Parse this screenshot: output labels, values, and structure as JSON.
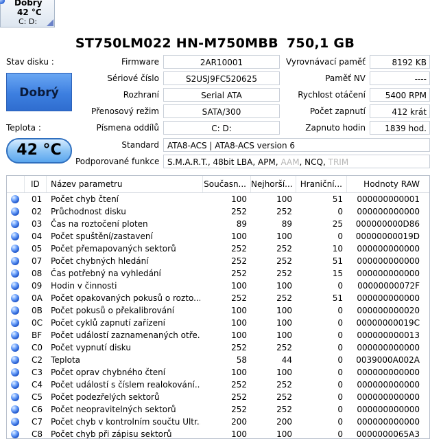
{
  "drive_tab": {
    "status": "Dobrý",
    "temperature": "42 °C",
    "letters": "C: D:"
  },
  "title": {
    "model": "ST750LM022 HN-M750MBB",
    "capacity": "750,1 GB"
  },
  "left": {
    "health_label": "Stav disku :",
    "health_value": "Dobrý",
    "temp_label": "Teplota :",
    "temp_value": "42 °C"
  },
  "info_center": [
    {
      "label": "Firmware",
      "value": "2AR10001"
    },
    {
      "label": "Sériové číslo",
      "value": "S2USJ9FC520625"
    },
    {
      "label": "Rozhraní",
      "value": "Serial ATA"
    },
    {
      "label": "Přenosový režim",
      "value": "SATA/300"
    },
    {
      "label": "Písmena oddílů",
      "value": "C: D:"
    }
  ],
  "info_right": [
    {
      "label": "Vyrovnávací paměť",
      "value": "8192 KB"
    },
    {
      "label": "Paměť NV",
      "value": "----"
    },
    {
      "label": "Rychlost otáčení",
      "value": "5400 RPM"
    },
    {
      "label": "Počet zapnutí",
      "value": "412 krát"
    },
    {
      "label": "Zapnuto hodin",
      "value": "1839 hod."
    }
  ],
  "standard": {
    "label": "Standard",
    "value": "ATA8-ACS | ATA8-ACS version 6"
  },
  "features": {
    "label": "Podporované funkce",
    "enabled": "S.M.A.R.T., 48bit LBA, APM,",
    "aam": "AAM",
    "ncq": ", NCQ,",
    "trim": "TRIM"
  },
  "table": {
    "headers": [
      "ID",
      "Název parametru",
      "Současn...",
      "Nejhorší...",
      "Hraniční...",
      "Hodnoty RAW"
    ],
    "rows": [
      [
        "01",
        "Počet chyb čtení",
        "100",
        "100",
        "51",
        "000000000001"
      ],
      [
        "02",
        "Průchodnost disku",
        "252",
        "252",
        "0",
        "000000000000"
      ],
      [
        "03",
        "Čas na roztočení ploten",
        "89",
        "89",
        "25",
        "000000000D86"
      ],
      [
        "04",
        "Počet spuštění/zastavení",
        "100",
        "100",
        "0",
        "00000000019D"
      ],
      [
        "05",
        "Počet přemapovaných sektorů",
        "252",
        "252",
        "10",
        "000000000000"
      ],
      [
        "07",
        "Počet chybných hledání",
        "252",
        "252",
        "51",
        "000000000000"
      ],
      [
        "08",
        "Čas potřebný na vyhledání",
        "252",
        "252",
        "15",
        "000000000000"
      ],
      [
        "09",
        "Hodin v činnosti",
        "100",
        "100",
        "0",
        "00000000072F"
      ],
      [
        "0A",
        "Počet opakovaných pokusů o rozto...",
        "252",
        "252",
        "51",
        "000000000000"
      ],
      [
        "0B",
        "Počet pokusů o překalibrování",
        "100",
        "100",
        "0",
        "000000000020"
      ],
      [
        "0C",
        "Počet cyklů zapnutí zařízení",
        "100",
        "100",
        "0",
        "00000000019C"
      ],
      [
        "BF",
        "Počet událostí zaznamenaných otře...",
        "100",
        "100",
        "0",
        "000000000013"
      ],
      [
        "C0",
        "Počet vypnutí disku",
        "252",
        "252",
        "0",
        "000000000000"
      ],
      [
        "C2",
        "Teplota",
        "58",
        "44",
        "0",
        "0039000A002A"
      ],
      [
        "C3",
        "Počet oprav chybného čtení",
        "100",
        "100",
        "0",
        "000000000000"
      ],
      [
        "C4",
        "Počet událostí s číslem realokování...",
        "252",
        "252",
        "0",
        "000000000000"
      ],
      [
        "C5",
        "Počet podezřelých sektorů",
        "252",
        "252",
        "0",
        "000000000000"
      ],
      [
        "C6",
        "Počet neopravitelných sektorů",
        "252",
        "252",
        "0",
        "000000000000"
      ],
      [
        "C7",
        "Počet chyb v kontrolním součtu Ultr...",
        "200",
        "200",
        "0",
        "000000000000"
      ],
      [
        "C8",
        "Počet chyb při zápisu sektorů",
        "100",
        "100",
        "0",
        "0000000065A3"
      ]
    ]
  }
}
